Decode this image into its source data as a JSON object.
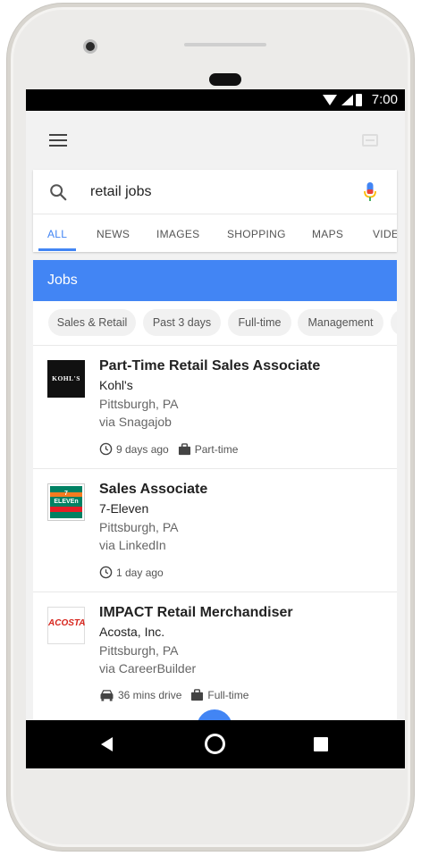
{
  "status": {
    "time": "7:00"
  },
  "search": {
    "query": "retail jobs"
  },
  "tabs": [
    {
      "label": "ALL",
      "active": true
    },
    {
      "label": "NEWS"
    },
    {
      "label": "IMAGES"
    },
    {
      "label": "SHOPPING"
    },
    {
      "label": "MAPS"
    },
    {
      "label": "VIDE"
    }
  ],
  "jobs_section": {
    "title": "Jobs"
  },
  "chips": [
    "Sales & Retail",
    "Past 3 days",
    "Full-time",
    "Management"
  ],
  "jobs": [
    {
      "title": "Part-Time Retail Sales Associate",
      "company": "Kohl's",
      "location": "Pittsburgh, PA",
      "source": "via Snagajob",
      "logo_text": "KOHL'S",
      "posted": "9 days ago",
      "type": "Part-time"
    },
    {
      "title": "Sales Associate",
      "company": "7-Eleven",
      "location": "Pittsburgh, PA",
      "source": "via LinkedIn",
      "logo_text": "7 ELEVEn",
      "posted": "1 day ago"
    },
    {
      "title": "IMPACT Retail Merchandiser",
      "company": "Acosta, Inc.",
      "location": "Pittsburgh, PA",
      "source": "via CareerBuilder",
      "logo_text": "ACOSTA",
      "drive": "36 mins drive",
      "type": "Full-time"
    }
  ],
  "colors": {
    "accent": "#4285f4",
    "kohls": "#111111",
    "seven_green": "#008163",
    "seven_orange": "#f47b20",
    "seven_red": "#e51e25",
    "acosta_red": "#d7261e"
  },
  "icons": [
    "menu-icon",
    "tabs-icon",
    "search-icon",
    "mic-icon",
    "clock-icon",
    "briefcase-icon",
    "car-icon",
    "back-icon",
    "home-icon",
    "recents-icon"
  ]
}
